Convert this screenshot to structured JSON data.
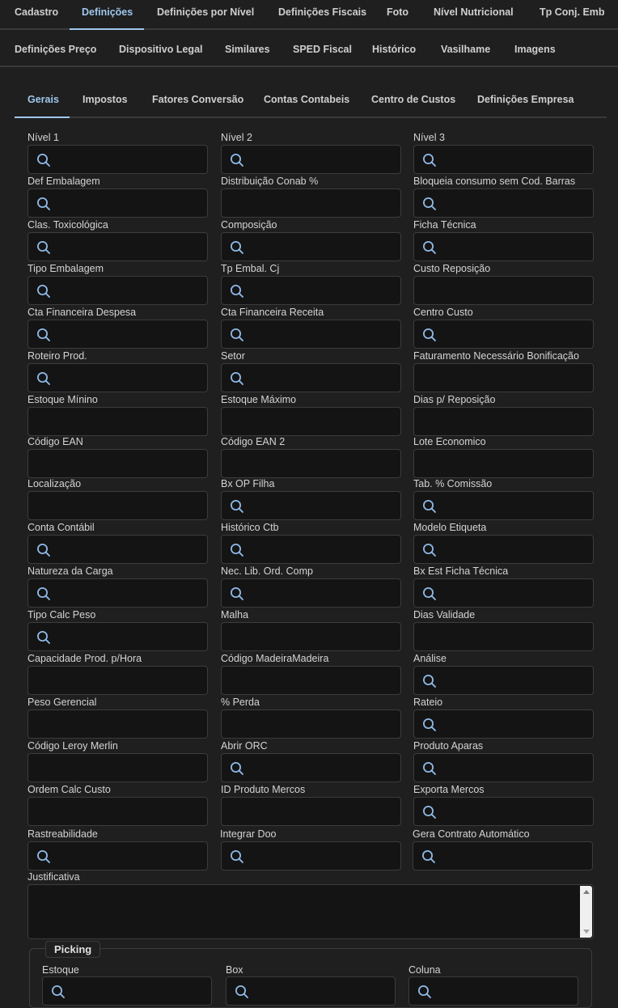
{
  "top_tabs_row1": [
    "Cadastro",
    "Definições",
    "Definições por Nível",
    "Definições Fiscais",
    "Foto",
    "Nível Nutricional",
    "Tp Conj. Emb"
  ],
  "top_tabs_row2": [
    "Definições Preço",
    "Dispositivo Legal",
    "Similares",
    "SPED Fiscal",
    "Histórico",
    "Vasilhame",
    "Imagens"
  ],
  "sub_tabs": [
    "Gerais",
    "Impostos",
    "Fatores Conversão",
    "Contas Contabeis",
    "Centro de Custos",
    "Definições Empresa"
  ],
  "active_top_tab": "Definições",
  "active_sub_tab": "Gerais",
  "fields": [
    [
      {
        "label": "Nível 1",
        "search": true
      },
      {
        "label": "Nível 2",
        "search": true
      },
      {
        "label": "Nível 3",
        "search": true
      }
    ],
    [
      {
        "label": "Def Embalagem",
        "search": true
      },
      {
        "label": "Distribuição Conab %",
        "search": false
      },
      {
        "label": "Bloqueia consumo sem Cod. Barras",
        "search": true
      }
    ],
    [
      {
        "label": "Clas. Toxicológica",
        "search": true
      },
      {
        "label": "Composição",
        "search": true
      },
      {
        "label": "Ficha Técnica",
        "search": true
      }
    ],
    [
      {
        "label": "Tipo Embalagem",
        "search": true
      },
      {
        "label": "Tp Embal. Cj",
        "search": true
      },
      {
        "label": "Custo Reposição",
        "search": false
      }
    ],
    [
      {
        "label": "Cta Financeira Despesa",
        "search": true
      },
      {
        "label": "Cta Financeira Receita",
        "search": true
      },
      {
        "label": "Centro Custo",
        "search": true
      }
    ],
    [
      {
        "label": "Roteiro Prod.",
        "search": true
      },
      {
        "label": "Setor",
        "search": true
      },
      {
        "label": "Faturamento Necessário Bonificação",
        "search": false
      }
    ],
    [
      {
        "label": "Estoque Mínino",
        "search": false
      },
      {
        "label": "Estoque Máximo",
        "search": false
      },
      {
        "label": "Dias p/ Reposição",
        "search": false
      }
    ],
    [
      {
        "label": "Código EAN",
        "search": false
      },
      {
        "label": "Código EAN 2",
        "search": false
      },
      {
        "label": "Lote Economico",
        "search": false
      }
    ],
    [
      {
        "label": "Localização",
        "search": false
      },
      {
        "label": "Bx OP Filha",
        "search": true
      },
      {
        "label": "Tab. % Comissão",
        "search": true
      }
    ],
    [
      {
        "label": "Conta Contábil",
        "search": true
      },
      {
        "label": "Histórico Ctb",
        "search": true
      },
      {
        "label": "Modelo Etiqueta",
        "search": true
      }
    ],
    [
      {
        "label": "Natureza da Carga",
        "search": true
      },
      {
        "label": "Nec. Lib. Ord. Comp",
        "search": true
      },
      {
        "label": "Bx Est Ficha Técnica",
        "search": true
      }
    ],
    [
      {
        "label": "Tipo Calc Peso",
        "search": true
      },
      {
        "label": "Malha",
        "search": false
      },
      {
        "label": "Dias Validade",
        "search": false
      }
    ],
    [
      {
        "label": "Capacidade Prod. p/Hora",
        "search": false
      },
      {
        "label": "Código MadeiraMadeira",
        "search": false
      },
      {
        "label": "Análise",
        "search": true
      }
    ],
    [
      {
        "label": "Peso Gerencial",
        "search": false
      },
      {
        "label": "% Perda",
        "search": false
      },
      {
        "label": "Rateio",
        "search": true
      }
    ],
    [
      {
        "label": "Código Leroy Merlin",
        "search": false
      },
      {
        "label": "Abrir ORC",
        "search": true
      },
      {
        "label": "Produto Aparas",
        "search": true
      }
    ],
    [
      {
        "label": "Ordem Calc Custo",
        "search": false
      },
      {
        "label": "ID Produto Mercos",
        "search": false
      },
      {
        "label": "Exporta Mercos",
        "search": true
      }
    ],
    [
      {
        "label": "Rastreabilidade",
        "search": true
      },
      {
        "label": "Integrar Doo",
        "search": true
      },
      {
        "label": "Gera Contrato Automático",
        "search": true
      }
    ]
  ],
  "justificativa_label": "Justificativa",
  "picking": {
    "legend": "Picking",
    "fields": [
      {
        "label": "Estoque",
        "search": true
      },
      {
        "label": "Box",
        "search": true
      },
      {
        "label": "Coluna",
        "search": true
      }
    ]
  }
}
